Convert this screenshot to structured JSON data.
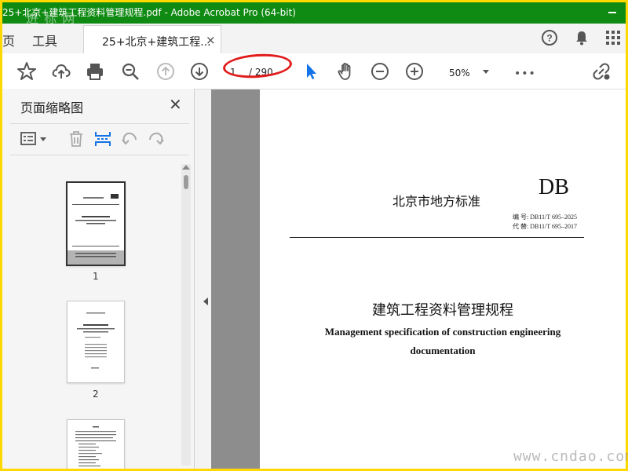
{
  "window": {
    "title": "25+北京+建筑工程资料管理规程.pdf - Adobe Acrobat Pro (64-bit)",
    "minimize": "minimize"
  },
  "tabs": {
    "home": "页",
    "tools": "工具",
    "doc": "25+北京+建筑工程...",
    "close": "×"
  },
  "toolbar": {
    "page_current": "1",
    "page_total": "/ 290",
    "zoom": "50%",
    "more": "•••"
  },
  "thumbnail_pane": {
    "title": "页面缩略图",
    "close": "✕",
    "thumbnails": [
      {
        "label": "1"
      },
      {
        "label": "2"
      }
    ]
  },
  "document": {
    "header": "北京市地方标准",
    "badge": "DB",
    "code_label": "编 号:",
    "code": "DB11/T 695–2025",
    "replace_label": "代 替:",
    "replace": "DB11/T 695–2017",
    "title_cn": "建筑工程资料管理规程",
    "title_en_1": "Management specification of construction engineering",
    "title_en_2": "documentation"
  },
  "watermarks": {
    "top_left": "进 标 网",
    "bottom_right": "www.cndao.com"
  },
  "colors": {
    "titlebar": "#0f8a12",
    "border": "#ffd800",
    "accent_blue": "#1473e6",
    "highlight_red": "#e21b1b"
  }
}
